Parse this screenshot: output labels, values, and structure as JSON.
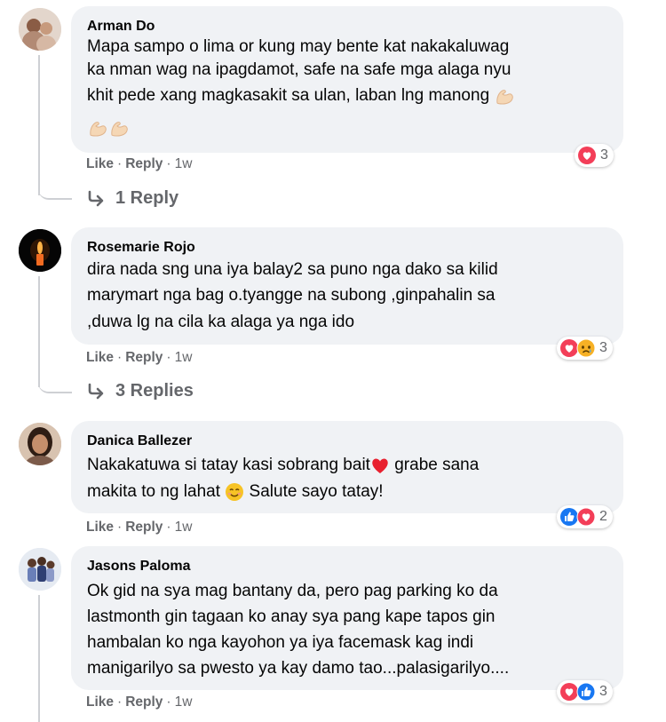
{
  "comments": [
    {
      "author": "Arman Do",
      "lines": [
        "Mapa sampo o lima or kung may bente kat nakakaluwag",
        "ka nman wag na ipagdamot, safe na safe mga alaga nyu",
        "khit pede xang magkasakit sa ulan, laban lng manong"
      ],
      "emoji": "flexed-biceps",
      "actions": {
        "like": "Like",
        "reply": "Reply",
        "time": "1w"
      },
      "reactions": {
        "icons": [
          "love-reaction"
        ],
        "count": "3"
      },
      "replies_label": "1 Reply"
    },
    {
      "author": "Rosemarie Rojo",
      "lines": [
        "dira nada sng una iya balay2 sa puno nga dako sa kilid",
        "marymart nga bag o.tyangge na subong ,ginpahalin sa",
        ",duwa lg na cila ka alaga ya nga ido"
      ],
      "actions": {
        "like": "Like",
        "reply": "Reply",
        "time": "1w"
      },
      "reactions": {
        "icons": [
          "love-reaction",
          "sad-reaction"
        ],
        "count": "3"
      },
      "replies_label": "3 Replies"
    },
    {
      "author": "Danica Ballezer",
      "lines": [
        "Nakakatuwa si tatay kasi sobrang bait",
        "grabe sana",
        "makita to ng lahat",
        "Salute sayo tatay!"
      ],
      "actions": {
        "like": "Like",
        "reply": "Reply",
        "time": "1w"
      },
      "reactions": {
        "icons": [
          "like-reaction",
          "love-reaction"
        ],
        "count": "2"
      }
    },
    {
      "author": "Jasons Paloma",
      "lines": [
        "Ok gid na sya mag bantany da, pero pag parking ko da",
        "lastmonth gin tagaan ko anay sya pang kape tapos gin",
        "hambalan ko nga kayohon ya iya facemask kag indi",
        "manigarilyo sa pwesto ya kay damo tao...palasigarilyo...."
      ],
      "actions": {
        "like": "Like",
        "reply": "Reply",
        "time": "1w"
      },
      "reactions": {
        "icons": [
          "love-reaction",
          "like-reaction"
        ],
        "count": "3"
      }
    }
  ],
  "colors": {
    "bubble": "#f0f2f5",
    "secondary_text": "#65676b",
    "love": "#f33e58",
    "like": "#1877f2",
    "sad": "#f7b125"
  }
}
